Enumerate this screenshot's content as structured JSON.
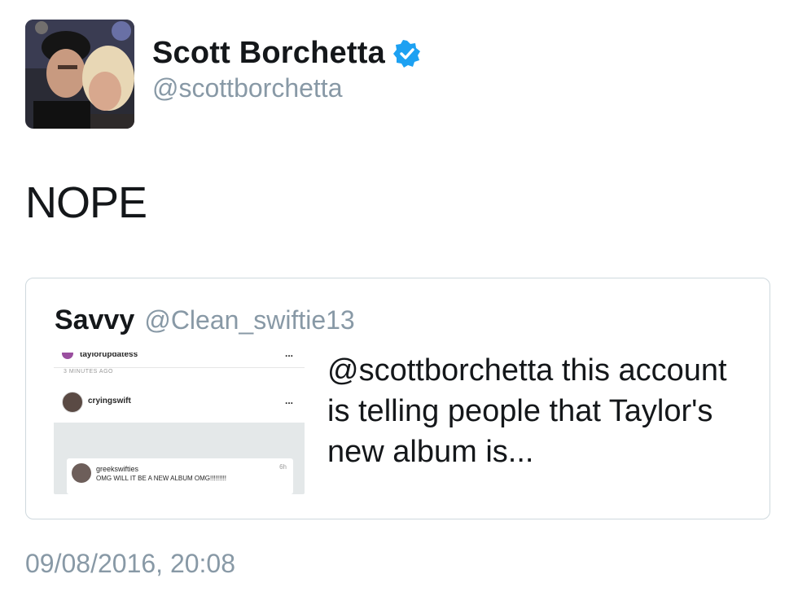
{
  "author": {
    "display_name": "Scott Borchetta",
    "handle": "@scottborchetta",
    "verified_icon": "verified-badge-icon",
    "verified_color": "#1da1f2"
  },
  "tweet": {
    "text": "NOPE",
    "timestamp": "09/08/2016, 20:08"
  },
  "quoted_tweet": {
    "display_name": "Savvy",
    "handle": "@Clean_swiftie13",
    "text": "@scottborchetta this account is telling people that Taylor's new album is...",
    "media": {
      "rows": [
        {
          "username": "taylorupdatess",
          "menu": "..."
        },
        {
          "username": "cryingswift",
          "menu": "..."
        }
      ],
      "time_ago": "3 MINUTES AGO",
      "comment": {
        "username": "greekswifties",
        "time": "6h",
        "text": "OMG WILL IT BE A NEW ALBUM OMG!!!!!!!!!"
      }
    }
  },
  "colors": {
    "text": "#14171a",
    "secondary": "#8899a6",
    "border": "#cfd9de"
  }
}
